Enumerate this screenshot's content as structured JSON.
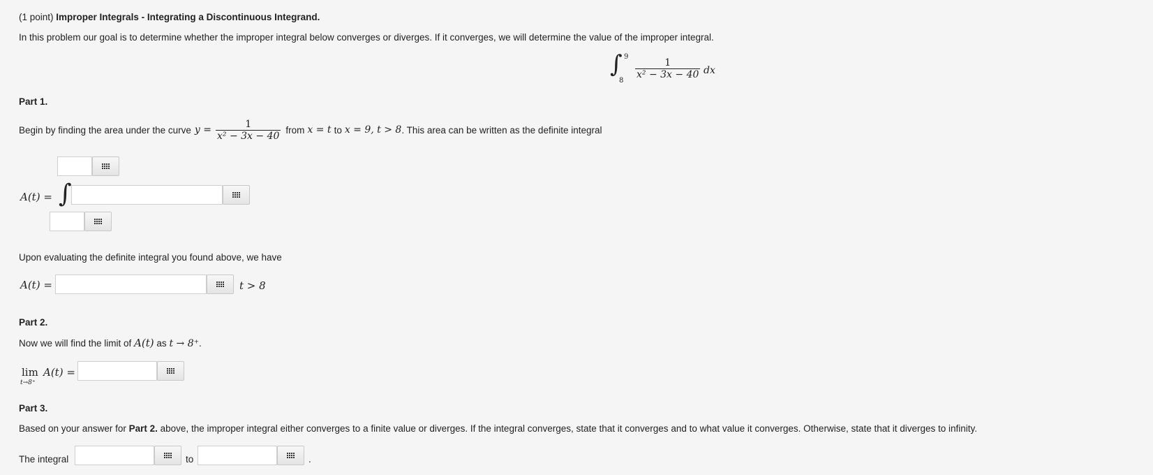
{
  "header": {
    "points": "(1 point)",
    "title": "Improper Integrals - Integrating a Discontinuous Integrand."
  },
  "intro": "In this problem our goal is to determine whether the improper integral below converges or diverges. If it converges, we will determine the value of the improper integral.",
  "main_integral": {
    "integral_sign": "∫",
    "upper": "9",
    "lower": "8",
    "numerator": "1",
    "denominator": "x² − 3x − 40",
    "differential": "dx"
  },
  "part1": {
    "heading": "Part 1.",
    "text_before": "Begin by finding the area under the curve",
    "y_eq": "y =",
    "numerator": "1",
    "denominator": "x² − 3x − 40",
    "from_word": "from",
    "from_expr": "x = t",
    "to_word": "to",
    "to_expr": "x = 9, t > 8",
    "text_after": ". This area can be written as the definite integral",
    "A_label": "A(t) =",
    "integral_sign": "∫",
    "evaluate_text": "Upon evaluating the definite integral you found above, we have",
    "A_label2": "A(t) =",
    "condition": "t > 8"
  },
  "part2": {
    "heading": "Part 2.",
    "text_before": "Now we will find the limit of",
    "A_expr": "A(t)",
    "as_word": "as",
    "limit_expr": "t → 8⁺",
    "text_after": ".",
    "lim_word": "lim",
    "lim_sub": "t→8⁺",
    "lim_expr": "A(t) ="
  },
  "part3": {
    "heading": "Part 3.",
    "text_prefix": "Based on your answer for",
    "text_bold": "Part 2.",
    "text_suffix": "above, the improper integral either converges to a finite value or diverges. If the integral converges, state that it converges and to what value it converges. Otherwise, state that it diverges to infinity.",
    "label": "The integral",
    "to_word": "to",
    "end_period": "."
  },
  "icons": {
    "palette": "equation-editor-grid-icon"
  }
}
